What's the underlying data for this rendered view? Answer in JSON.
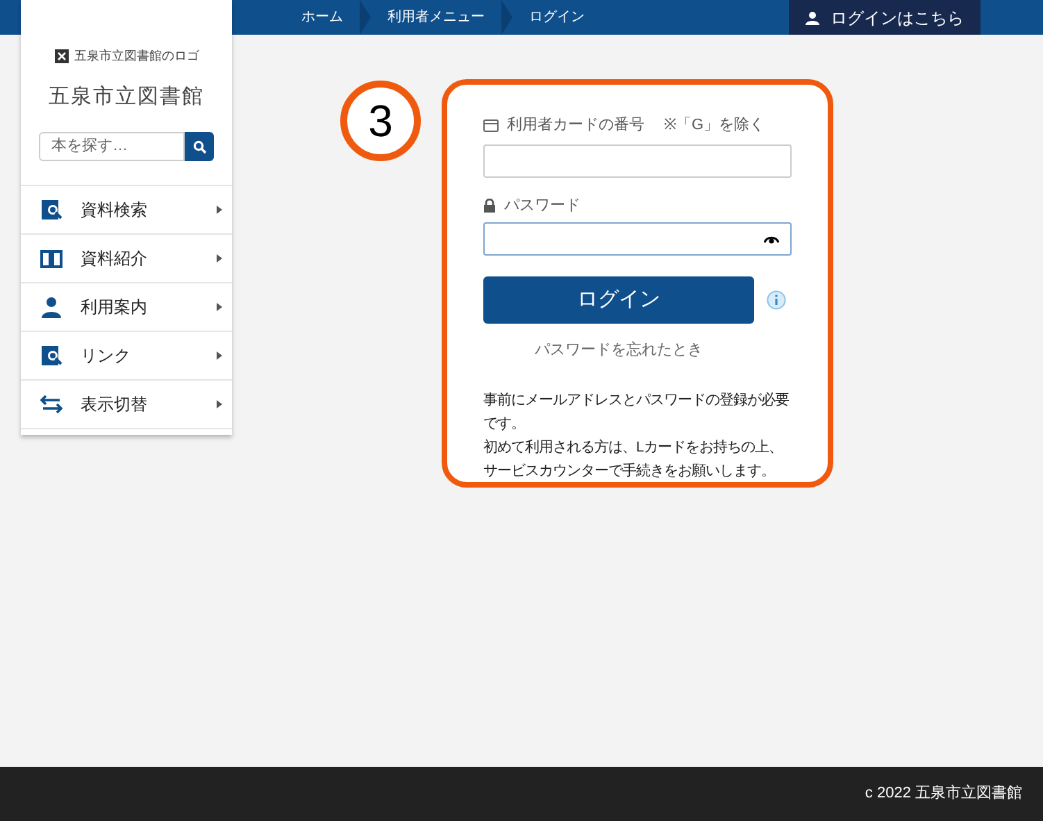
{
  "breadcrumb": [
    {
      "label": "ホーム"
    },
    {
      "label": "利用者メニュー"
    },
    {
      "label": "ログイン"
    }
  ],
  "header_login": {
    "label": "ログインはこちら"
  },
  "sidebar": {
    "logo_alt": "五泉市立図書館のロゴ",
    "title": "五泉市立図書館",
    "search": {
      "placeholder": "本を探す…"
    },
    "items": [
      {
        "label": "資料検索",
        "kind": "search"
      },
      {
        "label": "資料紹介",
        "kind": "book"
      },
      {
        "label": "利用案内",
        "kind": "person"
      },
      {
        "label": "リンク",
        "kind": "search"
      },
      {
        "label": "表示切替",
        "kind": "switch"
      }
    ]
  },
  "step_marker": "3",
  "login_form": {
    "card_label": "利用者カードの番号",
    "card_note": "※「G」を除く",
    "password_label": "パスワード",
    "password_focused": true,
    "login_button": "ログイン",
    "forgot_link": "パスワードを忘れたとき",
    "notice": [
      "事前にメールアドレスとパスワードの登録が必要です。",
      "初めて利用される方は、Lカードをお持ちの上、サービスカウンターで手続きをお願いします。"
    ]
  },
  "footer": "c 2022 五泉市立図書館"
}
